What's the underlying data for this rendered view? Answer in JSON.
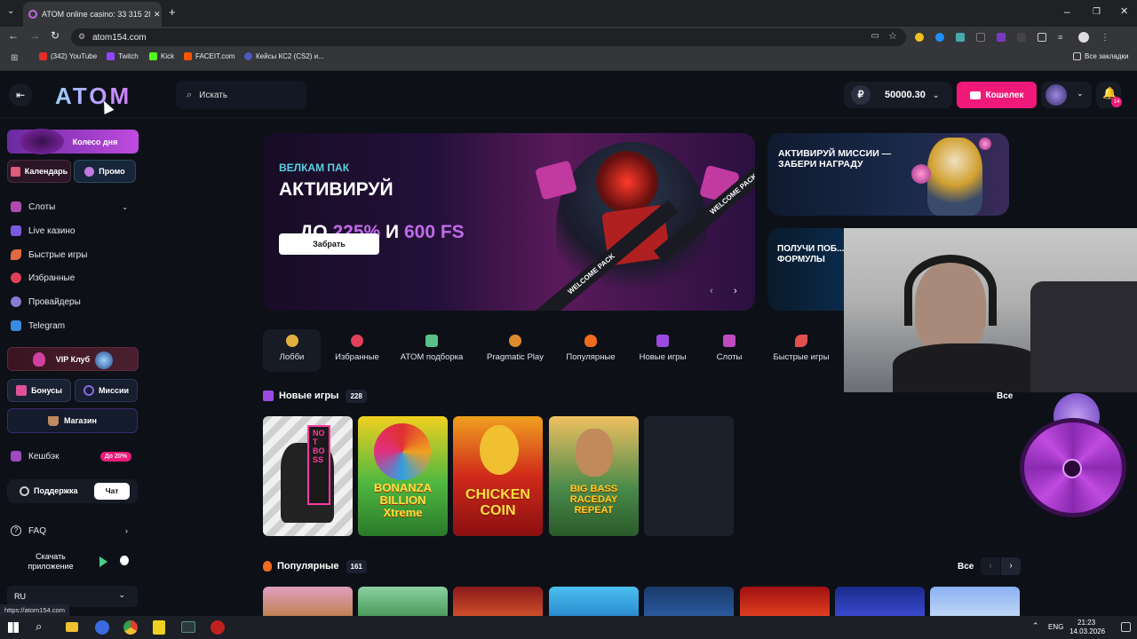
{
  "browser": {
    "tab_title": "ATOM online casino: 33 315 28...",
    "url": "atom154.com",
    "bookmarks": [
      "(342) YouTube",
      "Twitch",
      "Kick",
      "FACEIT.com",
      "Кейсы КС2 (CS2) и..."
    ],
    "all_bookmarks": "Все закладки",
    "status_url": "https://atom154.com"
  },
  "header": {
    "logo": "ATOM",
    "search_placeholder": "Искать",
    "balance": "50000.30",
    "currency_symbol": "₽",
    "wallet_label": "Кошелек",
    "notifications_count": "14"
  },
  "sidebar": {
    "wheel_label": "Колесо дня",
    "calendar_label": "Календарь",
    "promo_label": "Промо",
    "items": [
      {
        "label": "Слоты",
        "icon": "slots-icon"
      },
      {
        "label": "Live казино",
        "icon": "live-casino-icon"
      },
      {
        "label": "Быстрые игры",
        "icon": "rocket-icon"
      },
      {
        "label": "Избранные",
        "icon": "heart-icon"
      },
      {
        "label": "Провайдеры",
        "icon": "providers-icon"
      },
      {
        "label": "Telegram",
        "icon": "telegram-icon"
      }
    ],
    "vip_label": "VIP Клуб",
    "bonuses_label": "Бонусы",
    "missions_label": "Миссии",
    "shop_label": "Магазин",
    "cashback_label": "Кешбэк",
    "cashback_badge": "До 20%",
    "support_label": "Поддержка",
    "chat_label": "Чат",
    "faq_label": "FAQ",
    "download_label": "Скачать приложение",
    "language": "RU"
  },
  "banner": {
    "kicker": "ВЕЛКАМ ПАК",
    "headline_1": "АКТИВИРУЙ",
    "headline_2_prefix": "ДО ",
    "headline_2_pct": "225%",
    "headline_2_mid": " И ",
    "headline_2_fs": "600 FS",
    "cta": "Забрать",
    "ribbon": "WELCOME PACK"
  },
  "side_banners": {
    "missions_title": "АКТИВИРУЙ МИССИИ — ЗАБЕРИ НАГРАДУ",
    "formula_title": "ПОЛУЧИ ПОБ... ФОРМУЛЫ"
  },
  "categories": [
    {
      "label": "Лобби",
      "color": "#e0b040"
    },
    {
      "label": "Избранные",
      "color": "#e0405a"
    },
    {
      "label": "ATOM подборка",
      "color": "#5ac08a"
    },
    {
      "label": "Pragmatic Play",
      "color": "#e08a30"
    },
    {
      "label": "Популярные",
      "color": "#f06a20"
    },
    {
      "label": "Новые игры",
      "color": "#9a4ae0"
    },
    {
      "label": "Слоты",
      "color": "#c04ac0"
    },
    {
      "label": "Быстрые игры",
      "color": "#e05050"
    }
  ],
  "new_games": {
    "title": "Новые игры",
    "count": "228",
    "all": "Все",
    "games": [
      {
        "title": "NOT BOSS",
        "color": "#2a2a2a"
      },
      {
        "title": "BONANZA BILLION Xtreme",
        "color": "#3ba03a"
      },
      {
        "title": "CHICKEN COIN",
        "color": "#c0271e"
      },
      {
        "title": "BIG BASS RACEDAY REPEAT",
        "color": "#3f8a4a"
      }
    ]
  },
  "popular": {
    "title": "Популярные",
    "count": "161",
    "all": "Все"
  },
  "taskbar": {
    "lang": "ENG",
    "time": "21:23",
    "date": "14.03.2026"
  },
  "colors": {
    "accent_pink": "#f0197a",
    "accent_purple": "#8a3ae0",
    "bg": "#0d1117"
  }
}
